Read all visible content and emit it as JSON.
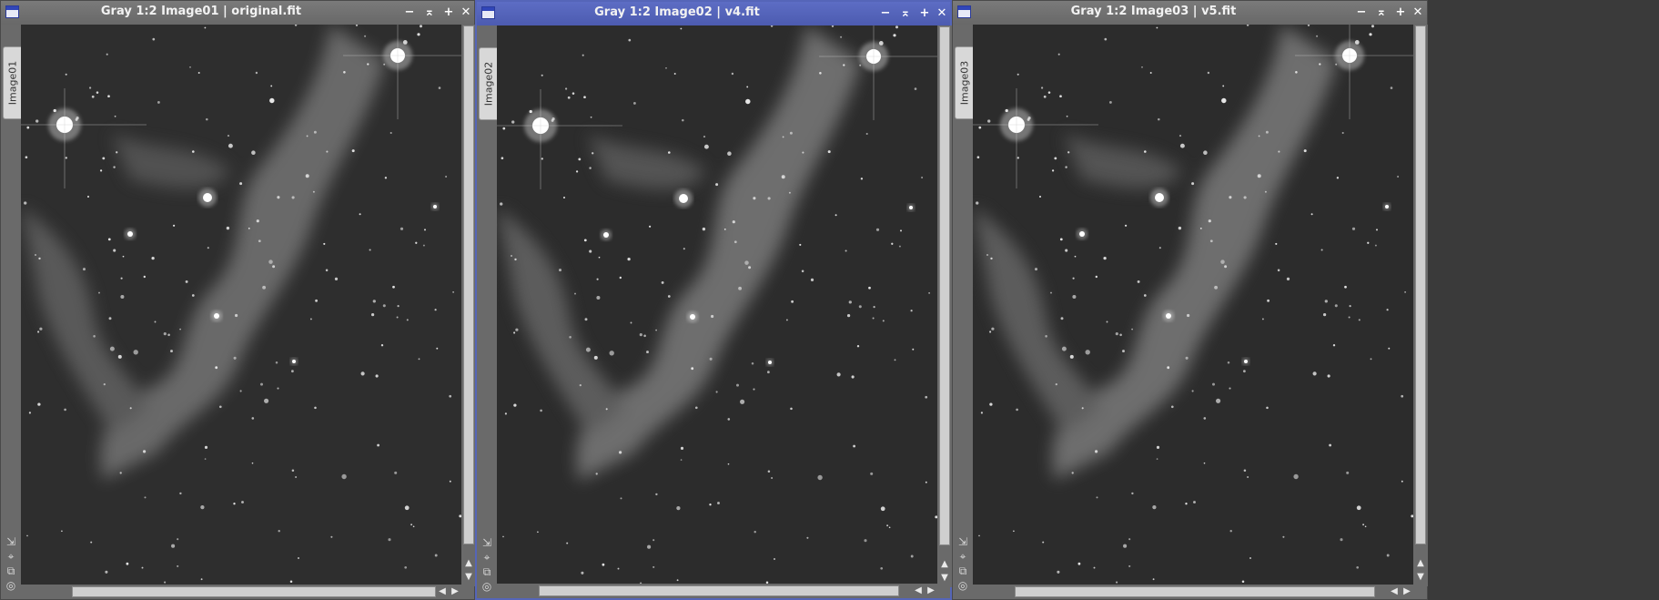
{
  "windows": [
    {
      "title": "Gray 1:2 Image01 | original.fit",
      "tab": "Image01",
      "active": false,
      "controls": {
        "minimize": "−",
        "shade": "⌅",
        "maximize": "+",
        "close": "✕"
      }
    },
    {
      "title": "Gray 1:2 Image02 | v4.fit",
      "tab": "Image02",
      "active": true,
      "controls": {
        "minimize": "−",
        "shade": "⌅",
        "maximize": "+",
        "close": "✕"
      }
    },
    {
      "title": "Gray 1:2 Image03 | v5.fit",
      "tab": "Image03",
      "active": false,
      "controls": {
        "minimize": "−",
        "shade": "⌅",
        "maximize": "+",
        "close": "✕"
      }
    }
  ],
  "side_icons": {
    "fit": "⇲",
    "zoom": "⌖",
    "clone": "⧉",
    "target": "◎"
  },
  "scroll_arrows": {
    "up": "▲",
    "down": "▼",
    "left": "◀",
    "right": "▶"
  },
  "colors": {
    "active_title": "#5565b8",
    "inactive_title": "#6f6f6f",
    "chrome": "#6a6a6a"
  }
}
